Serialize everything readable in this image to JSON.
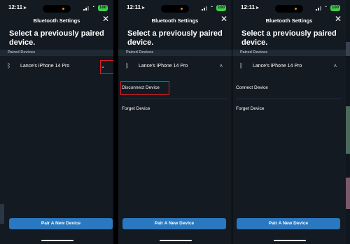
{
  "status": {
    "time": "12:11",
    "battery": "100"
  },
  "header": {
    "title": "Bluetooth Settings",
    "close_label": "✕"
  },
  "page": {
    "title": "Select a previously paired device."
  },
  "section": {
    "label": "Paired Devices"
  },
  "device": {
    "name": "Lance's iPhone 14 Pro"
  },
  "options": {
    "disconnect": "Disconnect Device",
    "connect": "Connect Device",
    "forget": "Forget Device"
  },
  "footer": {
    "pair_label": "Pair A New Device"
  },
  "icons": {
    "expand": "chevron-down-icon",
    "collapse": "chevron-up-icon",
    "bluetooth": "bluetooth-icon",
    "close": "close-icon"
  },
  "colors": {
    "background": "#131a22",
    "accent": "#2a78bf",
    "highlight": "#e01e26",
    "section": "#1f2a35"
  }
}
